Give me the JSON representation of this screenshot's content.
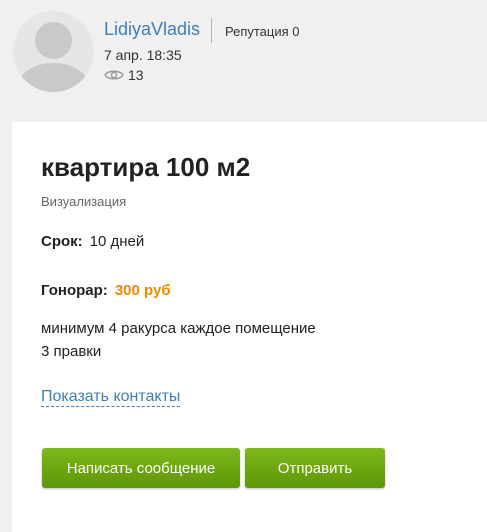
{
  "author": {
    "username": "LidiyaVladis",
    "reputation": "Репутация 0",
    "date": "7 апр. 18:35",
    "views": "13"
  },
  "task": {
    "title": "квартира 100 м2",
    "category": "Визуализация",
    "term_label": "Срок:",
    "term_value": "10 дней",
    "fee_label": "Гонорар:",
    "fee_value": "300 руб",
    "description_line1": "минимум 4 ракурса каждое помещение",
    "description_line2": "3 правки"
  },
  "actions": {
    "show_contacts": "Показать контакты",
    "write_message": "Написать сообщение",
    "send": "Отправить"
  },
  "colors": {
    "link": "#3f7fb5",
    "fee": "#f08a00",
    "button": "#6ea611"
  }
}
